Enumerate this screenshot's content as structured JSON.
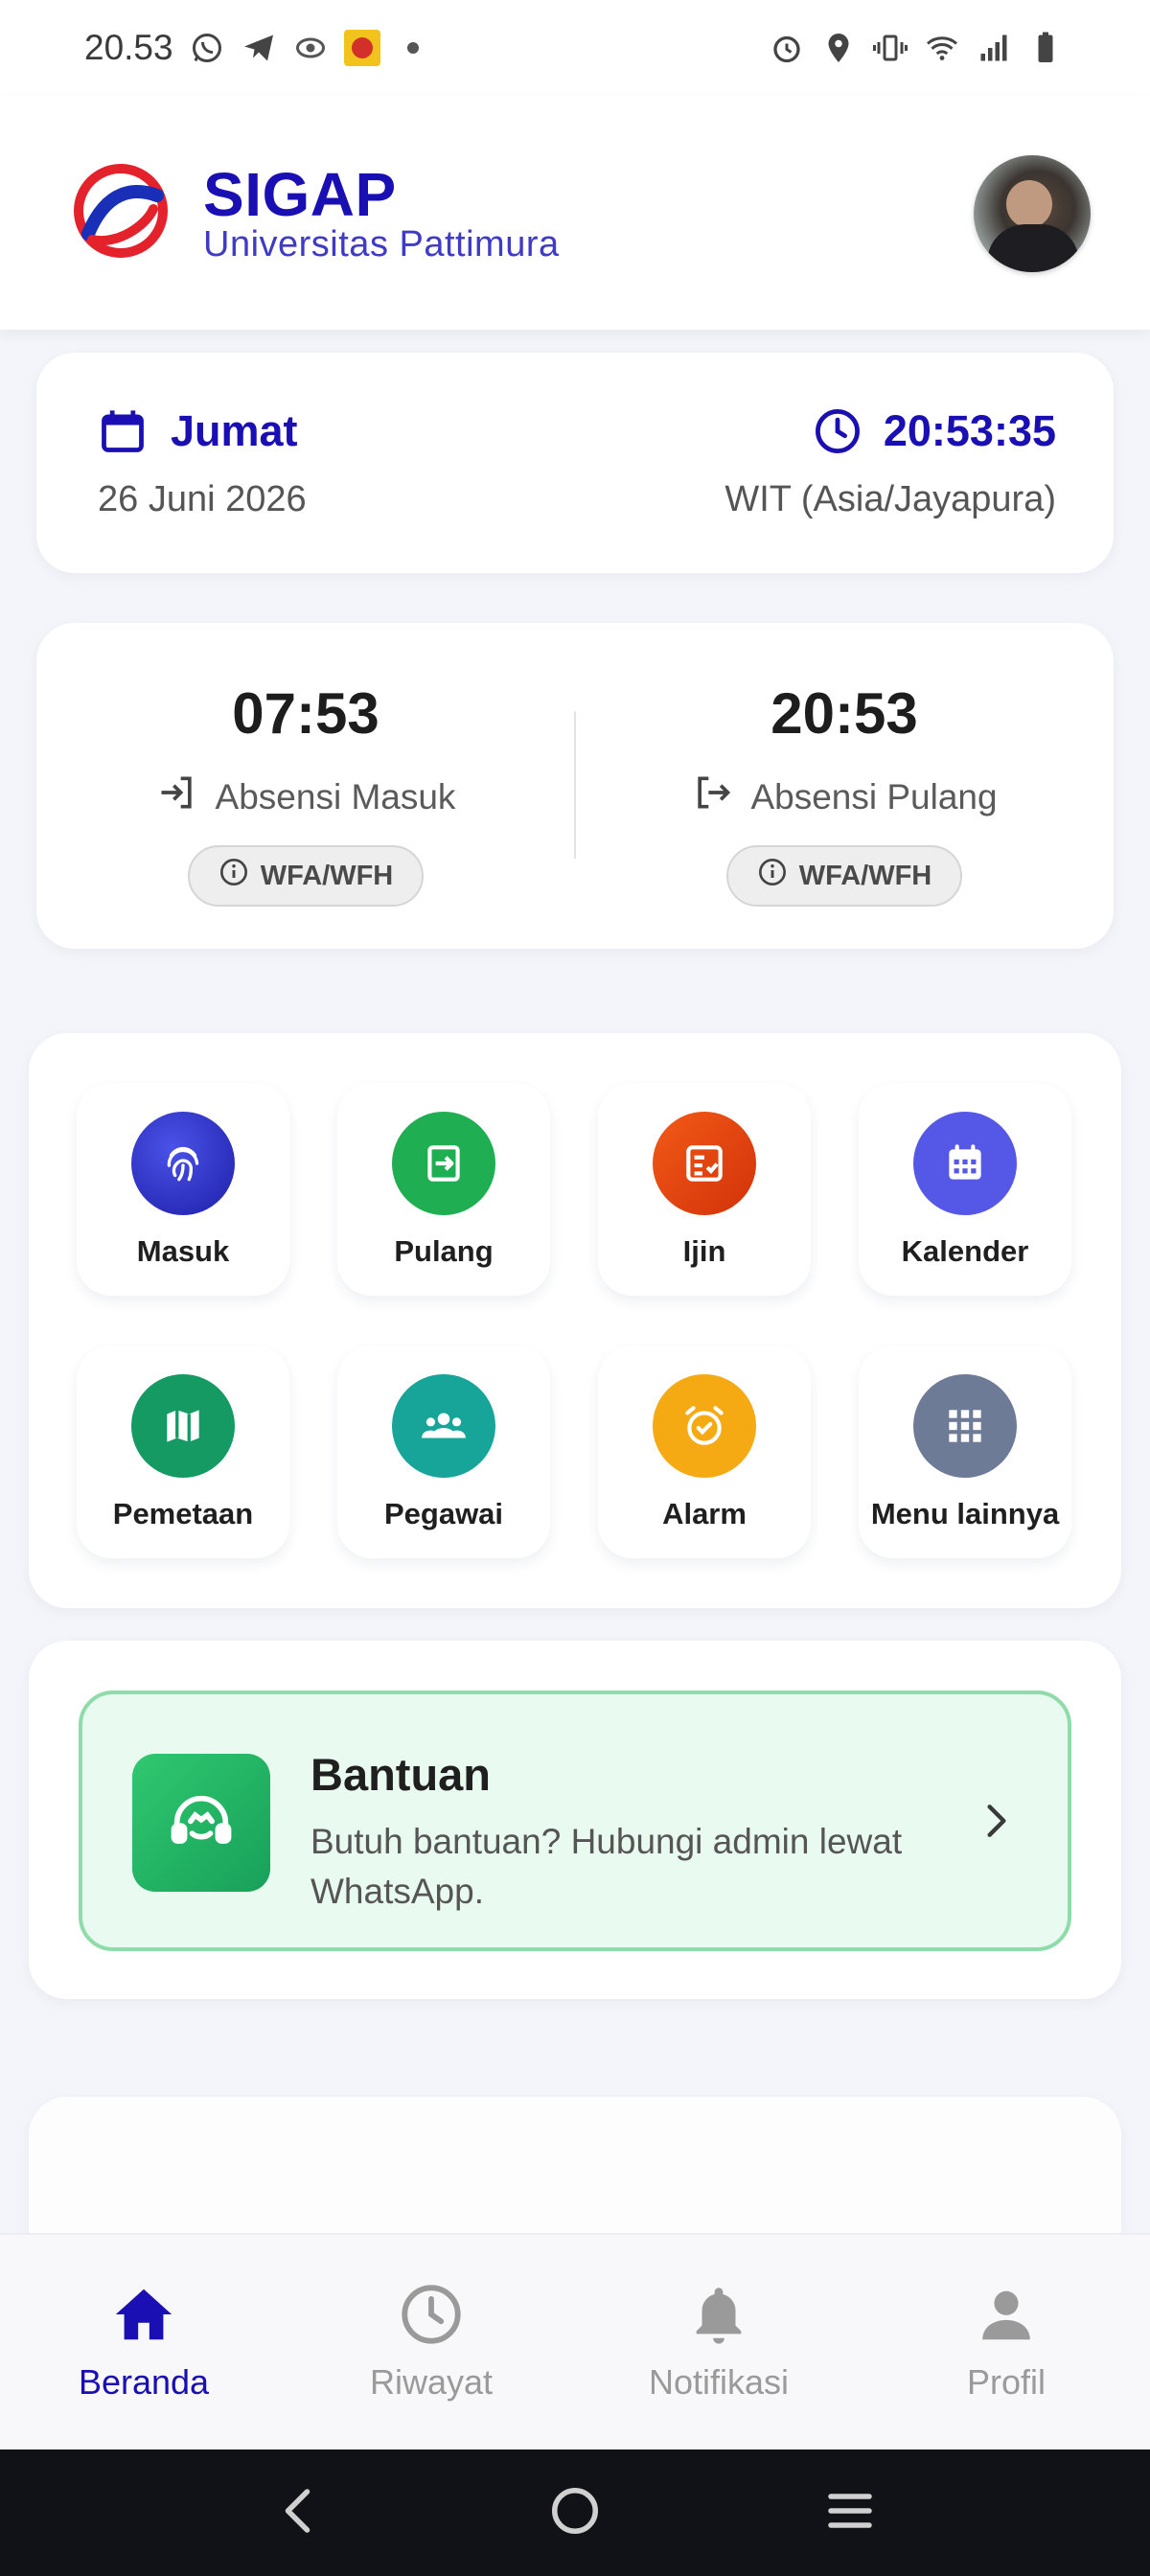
{
  "status_bar": {
    "time": "20.53"
  },
  "header": {
    "brand_title": "SIGAP",
    "brand_subtitle": "Universitas Pattimura"
  },
  "date_card": {
    "day": "Jumat",
    "date": "26 Juni 2026",
    "time": "20:53:35",
    "timezone": "WIT (Asia/Jayapura)"
  },
  "attendance": {
    "in": {
      "time": "07:53",
      "label": "Absensi Masuk",
      "badge": "WFA/WFH"
    },
    "out": {
      "time": "20:53",
      "label": "Absensi Pulang",
      "badge": "WFA/WFH"
    }
  },
  "menu": {
    "items": [
      {
        "label": "Masuk",
        "icon": "fingerprint-icon",
        "color": "#2a2fc4"
      },
      {
        "label": "Pulang",
        "icon": "exit-icon",
        "color": "#1fae52"
      },
      {
        "label": "Ijin",
        "icon": "form-check-icon",
        "color": "#e0400e"
      },
      {
        "label": "Kalender",
        "icon": "calendar-icon",
        "color": "#5558e6"
      },
      {
        "label": "Pemetaan",
        "icon": "map-icon",
        "color": "#149a62"
      },
      {
        "label": "Pegawai",
        "icon": "people-icon",
        "color": "#17a59a"
      },
      {
        "label": "Alarm",
        "icon": "alarm-icon",
        "color": "#f5aa14"
      },
      {
        "label": "Menu lainnya",
        "icon": "grid-icon",
        "color": "#6e7b97"
      }
    ]
  },
  "help": {
    "title": "Bantuan",
    "description": "Butuh bantuan? Hubungi admin lewat WhatsApp."
  },
  "bottom_nav": {
    "items": [
      {
        "label": "Beranda",
        "icon": "home-icon",
        "active": true
      },
      {
        "label": "Riwayat",
        "icon": "history-icon",
        "active": false
      },
      {
        "label": "Notifikasi",
        "icon": "bell-icon",
        "active": false
      },
      {
        "label": "Profil",
        "icon": "person-icon",
        "active": false
      }
    ]
  },
  "colors": {
    "primary": "#1a0fb3",
    "inactive": "#9a9a9a",
    "help_bg": "#e9fbf1",
    "help_border": "#8fdcaa"
  }
}
